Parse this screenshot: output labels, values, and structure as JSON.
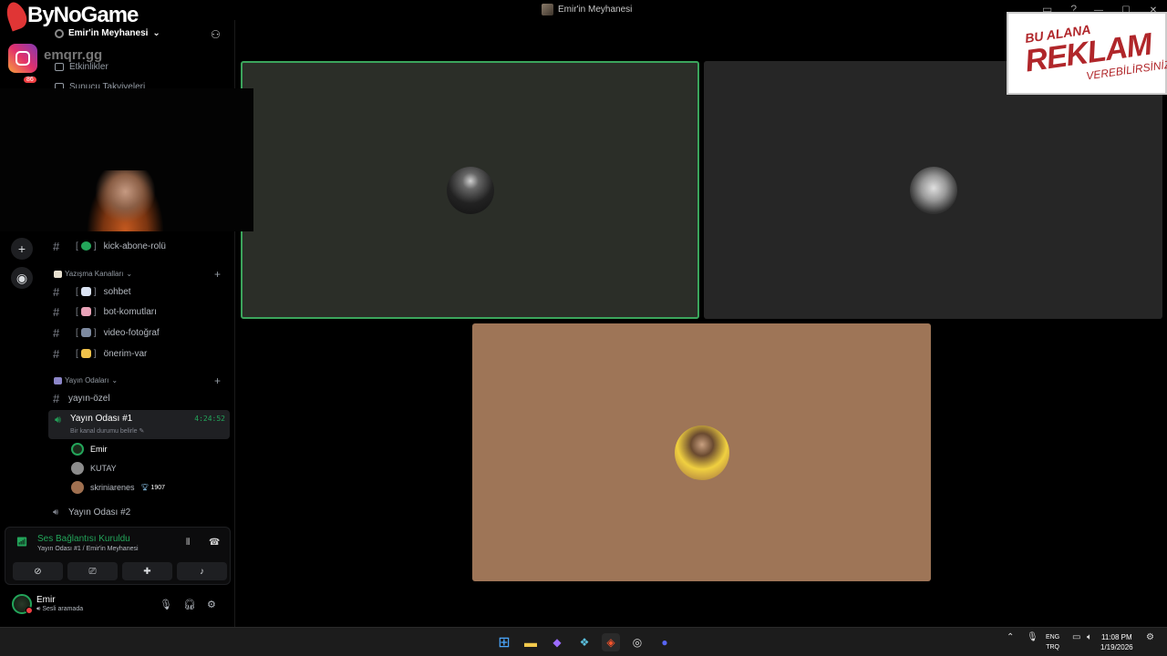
{
  "window": {
    "title": "Emir'in Meyhanesi"
  },
  "overlay": {
    "logo_text": "ByNoGame",
    "instagram_handle": "emqrr.gg",
    "notification_count": "86",
    "ad_line1": "BU ALANA",
    "ad_line2": "REKLAM",
    "ad_line3": "VEREBİLİRSİNİZ"
  },
  "sidebar": {
    "server_name": "Emir'in Meyhanesi",
    "menu": [
      "Etkinlikler",
      "Sunucu Takviyeleri"
    ],
    "channels_top": [
      {
        "name": "kick-abone-rolü"
      }
    ],
    "category_text": "Yazışma Kanalları",
    "text_channels": [
      {
        "name": "sohbet"
      },
      {
        "name": "bot-komutları"
      },
      {
        "name": "video-fotoğraf"
      },
      {
        "name": "önerim-var"
      }
    ],
    "category_voice": "Yayın Odaları",
    "voice_text_channel": "yayın-özel",
    "active_voice": {
      "name": "Yayın Odası #1",
      "time": "4:24:52",
      "status": "Bir kanal durumu belirle"
    },
    "voice_users": [
      {
        "name": "Emir",
        "badge": ""
      },
      {
        "name": "KUTAY",
        "badge": ""
      },
      {
        "name": "skriniarenes",
        "badge": "1907"
      }
    ],
    "voice_channel_2": "Yayın Odası #2"
  },
  "voice_panel": {
    "title": "Ses Bağlantısı Kuruldu",
    "subtitle": "Yayın Odası #1 / Emir'in Meyhanesi"
  },
  "user_panel": {
    "name": "Emir",
    "status": "Sesli aramada"
  },
  "taskbar": {
    "lang_top": "ENG",
    "lang_bottom": "TRQ",
    "time": "11:08 PM",
    "date": "1/19/2026"
  },
  "colors": {
    "accent_green": "#23a55a",
    "tile_1": "#2b2e28",
    "tile_2": "#262626",
    "tile_3": "#9e7557"
  }
}
